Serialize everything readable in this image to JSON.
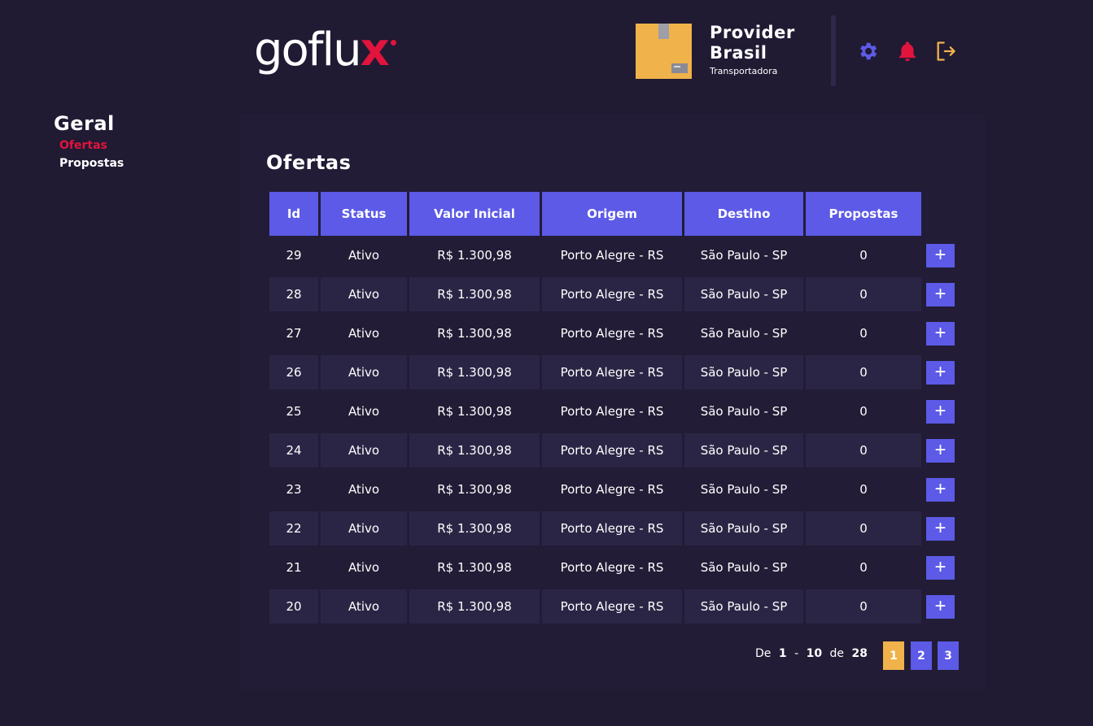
{
  "header": {
    "logo_main": "goflu",
    "logo_accent": "x",
    "provider_name_line1": "Provider",
    "provider_name_line2": "Brasil",
    "provider_type": "Transportadora",
    "icons": [
      "gear-icon",
      "bell-icon",
      "logout-icon"
    ],
    "colors": {
      "gear": "#5c5ae6",
      "bell": "#e0143c",
      "logout": "#f0b24a"
    }
  },
  "sidebar": {
    "title": "Geral",
    "items": [
      {
        "label": "Ofertas",
        "active": true
      },
      {
        "label": "Propostas",
        "active": false
      }
    ]
  },
  "main": {
    "title": "Ofertas",
    "columns": [
      "Id",
      "Status",
      "Valor Inicial",
      "Origem",
      "Destino",
      "Propostas"
    ],
    "rows": [
      {
        "id": "29",
        "status": "Ativo",
        "valor": "R$ 1.300,98",
        "origem": "Porto Alegre - RS",
        "destino": "São Paulo - SP",
        "propostas": "0"
      },
      {
        "id": "28",
        "status": "Ativo",
        "valor": "R$ 1.300,98",
        "origem": "Porto Alegre - RS",
        "destino": "São Paulo - SP",
        "propostas": "0"
      },
      {
        "id": "27",
        "status": "Ativo",
        "valor": "R$ 1.300,98",
        "origem": "Porto Alegre - RS",
        "destino": "São Paulo - SP",
        "propostas": "0"
      },
      {
        "id": "26",
        "status": "Ativo",
        "valor": "R$ 1.300,98",
        "origem": "Porto Alegre - RS",
        "destino": "São Paulo - SP",
        "propostas": "0"
      },
      {
        "id": "25",
        "status": "Ativo",
        "valor": "R$ 1.300,98",
        "origem": "Porto Alegre - RS",
        "destino": "São Paulo - SP",
        "propostas": "0"
      },
      {
        "id": "24",
        "status": "Ativo",
        "valor": "R$ 1.300,98",
        "origem": "Porto Alegre - RS",
        "destino": "São Paulo - SP",
        "propostas": "0"
      },
      {
        "id": "23",
        "status": "Ativo",
        "valor": "R$ 1.300,98",
        "origem": "Porto Alegre - RS",
        "destino": "São Paulo - SP",
        "propostas": "0"
      },
      {
        "id": "22",
        "status": "Ativo",
        "valor": "R$ 1.300,98",
        "origem": "Porto Alegre - RS",
        "destino": "São Paulo - SP",
        "propostas": "0"
      },
      {
        "id": "21",
        "status": "Ativo",
        "valor": "R$ 1.300,98",
        "origem": "Porto Alegre - RS",
        "destino": "São Paulo - SP",
        "propostas": "0"
      },
      {
        "id": "20",
        "status": "Ativo",
        "valor": "R$ 1.300,98",
        "origem": "Porto Alegre - RS",
        "destino": "São Paulo - SP",
        "propostas": "0"
      }
    ],
    "add_button_label": "+"
  },
  "pagination": {
    "prefix": "De",
    "from": "1",
    "dash": "-",
    "to": "10",
    "of_label": "de",
    "total": "28",
    "pages": [
      "1",
      "2",
      "3"
    ],
    "current_page": "1"
  }
}
